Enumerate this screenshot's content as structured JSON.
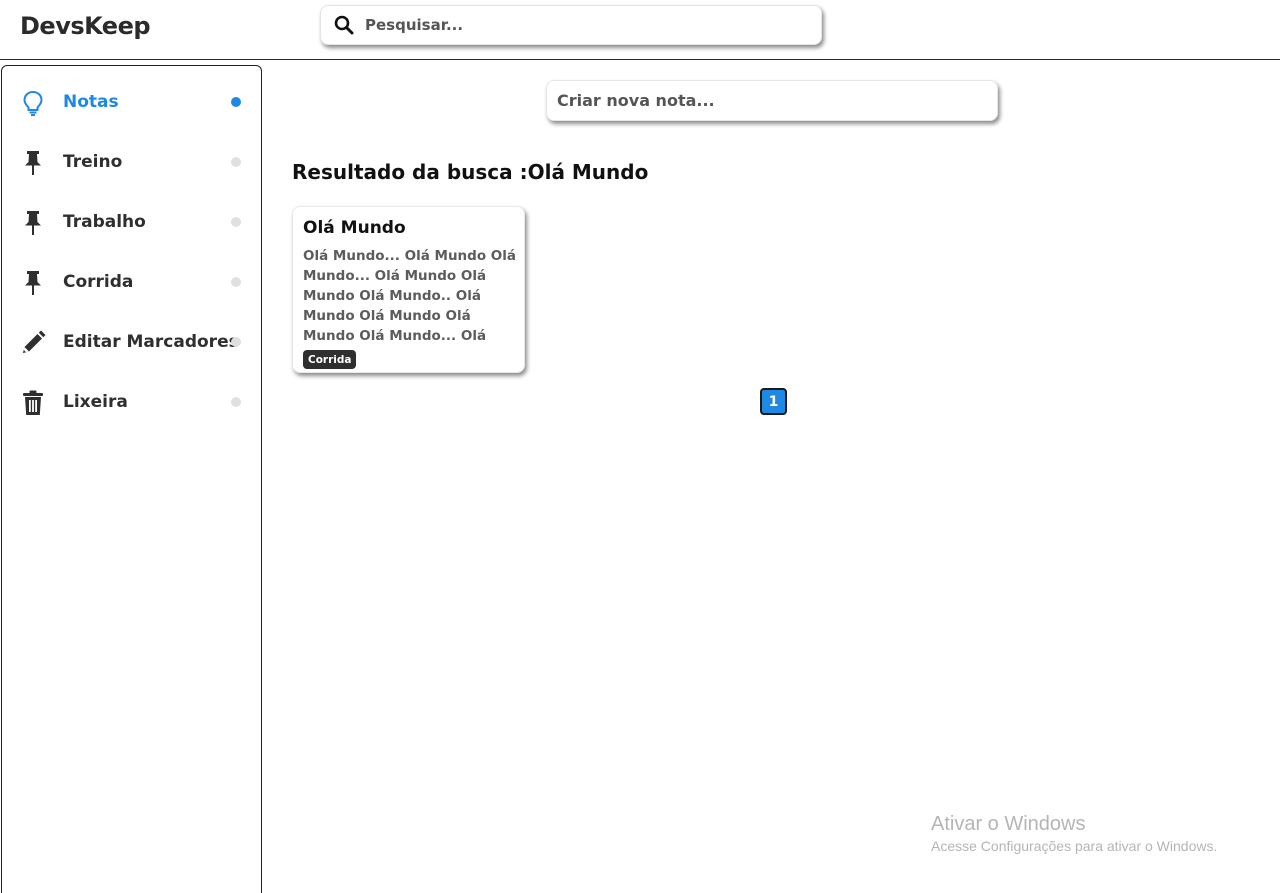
{
  "app": {
    "title": "DevsKeep"
  },
  "search": {
    "placeholder": "Pesquisar..."
  },
  "sidebar": {
    "items": [
      {
        "label": "Notas",
        "icon": "lightbulb-icon",
        "active": true
      },
      {
        "label": "Treino",
        "icon": "pin-icon",
        "active": false
      },
      {
        "label": "Trabalho",
        "icon": "pin-icon",
        "active": false
      },
      {
        "label": "Corrida",
        "icon": "pin-icon",
        "active": false
      },
      {
        "label": "Editar Marcadores",
        "icon": "pencil-icon",
        "active": false
      },
      {
        "label": "Lixeira",
        "icon": "trash-icon",
        "active": false
      }
    ]
  },
  "main": {
    "create_note_placeholder": "Criar nova nota...",
    "result_title": "Resultado da busca :Olá Mundo",
    "notes": [
      {
        "title": "Olá Mundo",
        "body": "Olá Mundo... Olá Mundo Olá Mundo... Olá Mundo Olá Mundo Olá Mundo.. Olá Mundo Olá Mundo Olá Mundo Olá Mundo... Olá",
        "tag": "Corrida"
      }
    ],
    "pagination": {
      "current": "1"
    }
  },
  "watermark": {
    "title": "Ativar o Windows",
    "subtitle": "Acesse Configurações para ativar o Windows."
  },
  "colors": {
    "accent": "#1e88e5",
    "dark": "#2f2f2f",
    "inactive_dot": "#e0e0e0"
  }
}
